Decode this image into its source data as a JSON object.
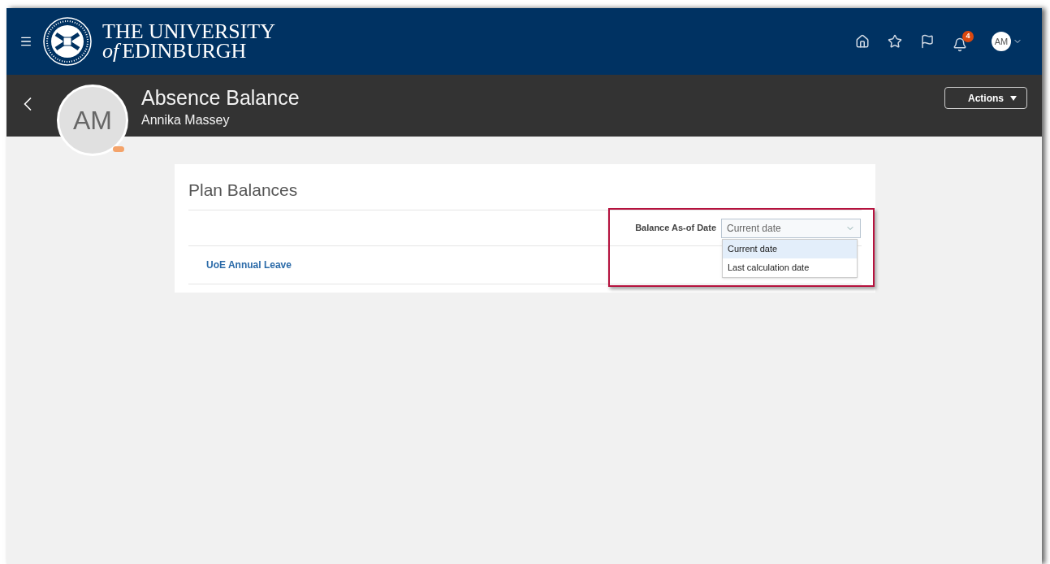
{
  "header": {
    "logo_line1": "THE UNIVERSITY",
    "logo_line2_prefix": "of",
    "logo_line2": "EDINBURGH",
    "notification_count": "4",
    "user_initials": "AM"
  },
  "page": {
    "title": "Absence Balance",
    "person": "Annika Massey",
    "avatar_initials": "AM",
    "actions_label": "Actions"
  },
  "card": {
    "title": "Plan Balances",
    "filter_label": "Balance As-of Date",
    "filter_value": "Current date",
    "dropdown_open": true,
    "highlighted": true,
    "options": [
      {
        "label": "Current date",
        "selected": true
      },
      {
        "label": "Last calculation date",
        "selected": false
      }
    ],
    "plans": [
      {
        "name": "UoE Annual Leave"
      }
    ]
  }
}
